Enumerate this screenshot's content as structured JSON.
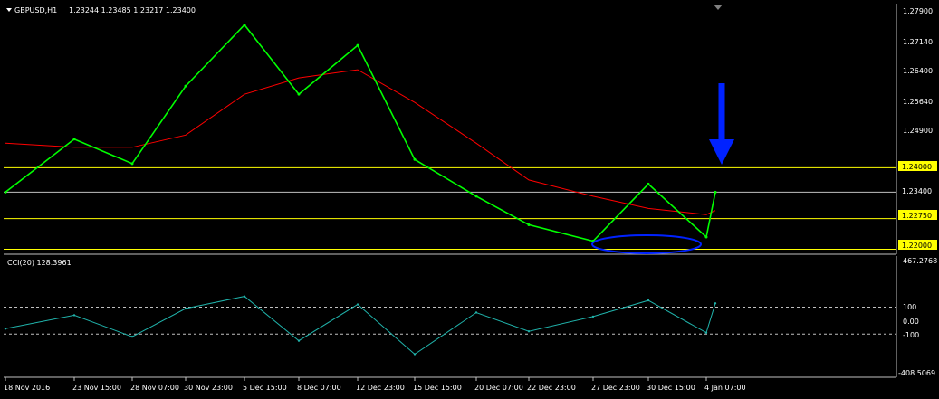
{
  "header": {
    "symbol": "GBPUSD,H1",
    "ohlc": "1.23244 1.23485 1.23217 1.23400",
    "menu_icon": "triangle-down-icon",
    "scroll_marker_icon": "triangle-down-icon"
  },
  "cci": {
    "label": "CCI(20) 128.3961",
    "max_label": "467.2768",
    "min_label": "-408.5069",
    "levels": [
      "100",
      "0.00",
      "-100"
    ]
  },
  "colors": {
    "background": "#000000",
    "price": "#00ff00",
    "moving_average": "#ff0000",
    "support_line": "#ffff00",
    "gray_line": "#c0c0c0",
    "cci_line": "#20b2aa",
    "arrow": "#0022ff",
    "ellipse": "#0022ff"
  },
  "chart_data": {
    "type": "line",
    "title": "GBPUSD,H1",
    "series": [
      {
        "kind": "price",
        "x": [
          "18 Nov 2016",
          "23 Nov 15:00",
          "28 Nov 07:00",
          "30 Nov 23:00",
          "5 Dec 15:00",
          "8 Dec 07:00",
          "12 Dec 23:00",
          "15 Dec 15:00",
          "20 Dec 07:00",
          "22 Dec 23:00",
          "27 Dec 23:00",
          "30 Dec 15:00",
          "4 Jan 07:00",
          "4 Jan 18:00"
        ],
        "y": [
          1.234,
          1.247,
          1.241,
          1.26,
          1.275,
          1.258,
          1.27,
          1.242,
          1.233,
          1.226,
          1.222,
          1.236,
          1.223,
          1.234
        ]
      },
      {
        "kind": "moving_average",
        "x": [
          "18 Nov 2016",
          "23 Nov 15:00",
          "28 Nov 07:00",
          "30 Nov 23:00",
          "5 Dec 15:00",
          "8 Dec 07:00",
          "12 Dec 23:00",
          "15 Dec 15:00",
          "20 Dec 07:00",
          "22 Dec 23:00",
          "27 Dec 23:00",
          "30 Dec 15:00",
          "4 Jan 07:00",
          "4 Jan 18:00"
        ],
        "y": [
          1.246,
          1.245,
          1.245,
          1.248,
          1.258,
          1.262,
          1.264,
          1.256,
          1.246,
          1.237,
          1.233,
          1.23,
          1.2285,
          1.2295
        ]
      },
      {
        "kind": "cci",
        "x": [
          "18 Nov 2016",
          "23 Nov 15:00",
          "28 Nov 07:00",
          "30 Nov 23:00",
          "5 Dec 15:00",
          "8 Dec 07:00",
          "12 Dec 23:00",
          "15 Dec 15:00",
          "20 Dec 07:00",
          "22 Dec 23:00",
          "27 Dec 23:00",
          "30 Dec 15:00",
          "4 Jan 07:00",
          "4 Jan 18:00"
        ],
        "y": [
          -60,
          40,
          -120,
          90,
          180,
          -150,
          120,
          -250,
          60,
          -80,
          30,
          150,
          -90,
          128.3961
        ]
      }
    ],
    "x_tick_labels": [
      "18 Nov 2016",
      "23 Nov 15:00",
      "28 Nov 07:00",
      "30 Nov 23:00",
      "5 Dec 15:00",
      "8 Dec 07:00",
      "12 Dec 23:00",
      "15 Dec 15:00",
      "20 Dec 07:00",
      "22 Dec 23:00",
      "27 Dec 23:00",
      "30 Dec 15:00",
      "4 Jan 07:00"
    ],
    "y_tick_labels": [
      "1.27900",
      "1.27140",
      "1.26400",
      "1.25640",
      "1.24900",
      "1.23400"
    ],
    "ylim": [
      1.219,
      1.28
    ],
    "horizontal_lines": [
      {
        "value": 1.24,
        "label": "1.24000",
        "color": "yellow"
      },
      {
        "value": 1.234,
        "label": "1.23400",
        "color": "gray"
      },
      {
        "value": 1.2275,
        "label": "1.22750",
        "color": "yellow"
      },
      {
        "value": 1.22,
        "label": "1.22000",
        "color": "yellow"
      }
    ],
    "cci_ylim": [
      -408.5069,
      467.2768
    ],
    "cci_levels": [
      100,
      0,
      -100
    ],
    "annotations": [
      {
        "type": "arrow",
        "direction": "down",
        "color": "blue",
        "at": "4 Jan 18:00"
      },
      {
        "type": "ellipse",
        "color": "blue",
        "around": "27 Dec 23:00 to 4 Jan 07:00 lows near 1.22000"
      }
    ],
    "grid": false,
    "legend": "none"
  }
}
